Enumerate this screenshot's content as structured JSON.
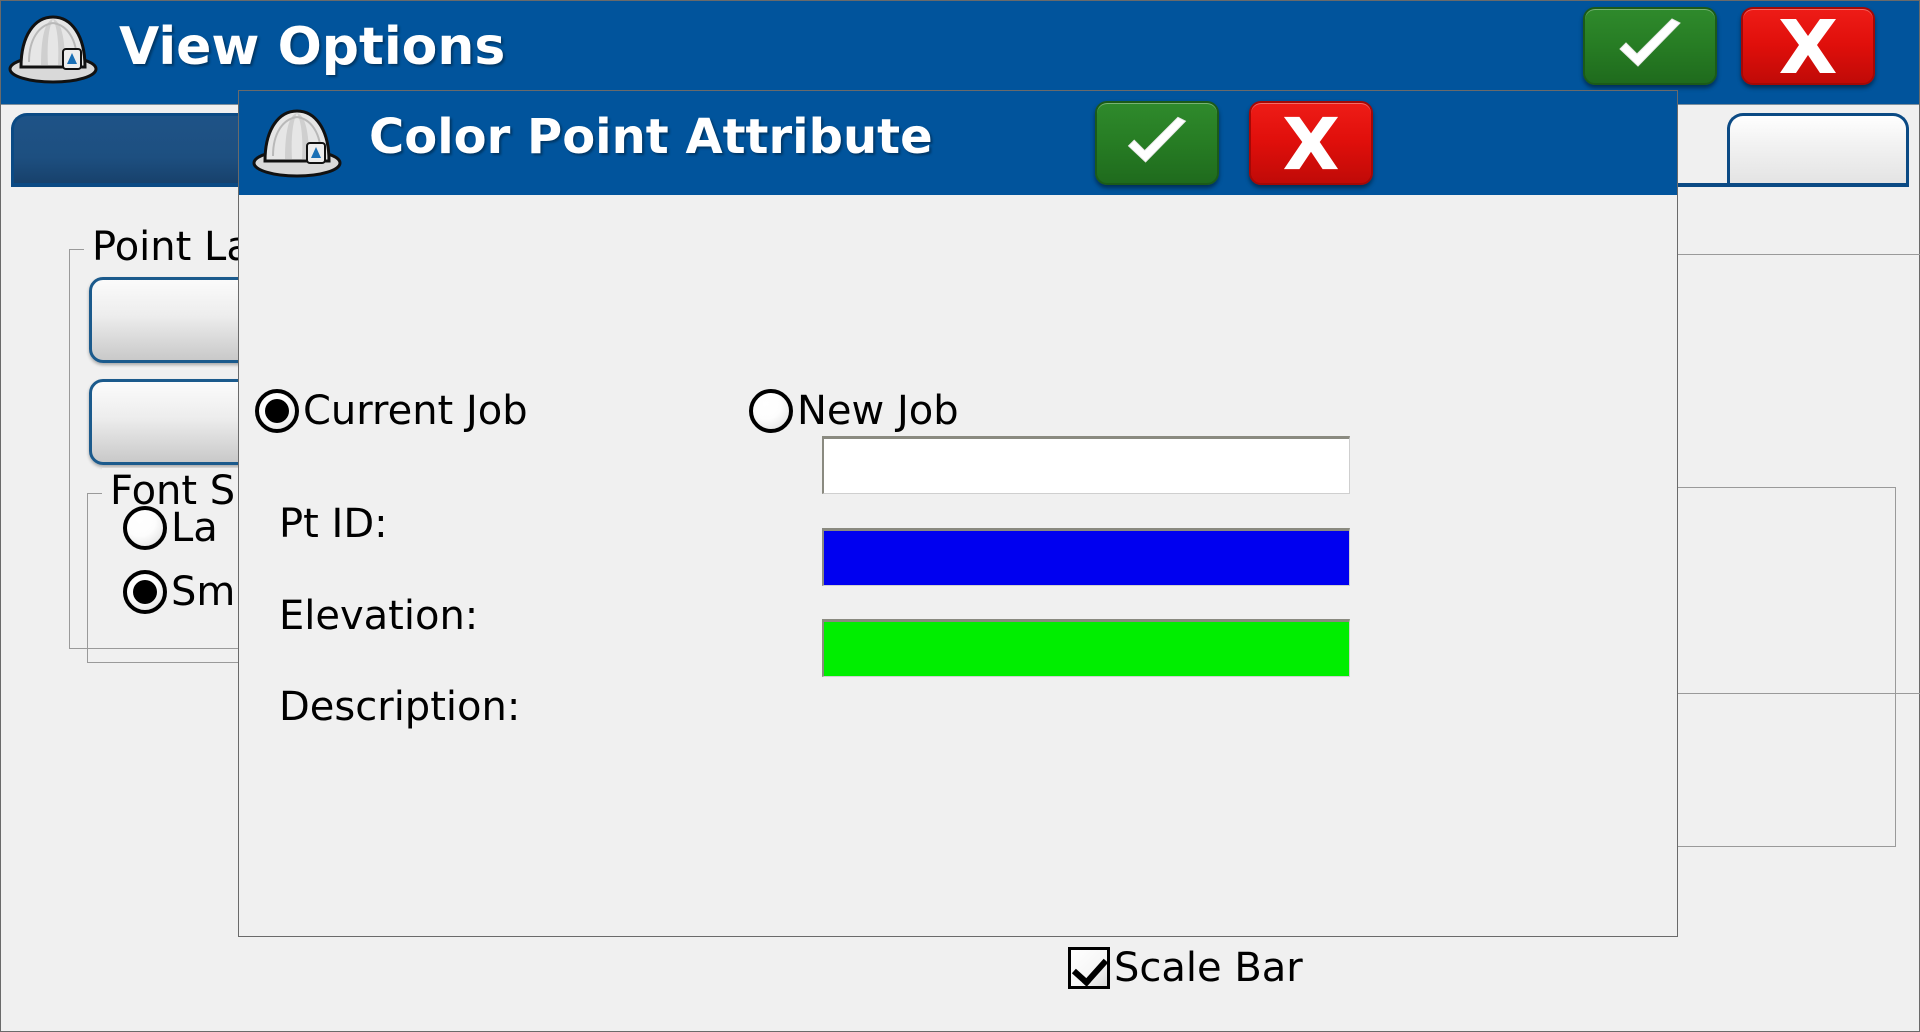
{
  "main_window": {
    "title": "View Options",
    "icon": "hardhat-icon",
    "confirm_label": "OK",
    "cancel_label": "Cancel",
    "confirm_icon": "check-icon",
    "cancel_icon": "x-icon",
    "tabs": [
      {
        "label": "",
        "state": "active"
      },
      {
        "label": "",
        "state": "inactive"
      }
    ],
    "groups": [
      {
        "title": "Point La",
        "full_title": "Point Labels"
      },
      {
        "title": "Font Si",
        "full_title": "Font Size"
      }
    ],
    "buttons": [
      {
        "label": ""
      },
      {
        "label": ""
      }
    ],
    "font_size_options": [
      {
        "label": "La",
        "full_label": "Large",
        "selected": false
      },
      {
        "label": "Sm",
        "full_label": "Small",
        "selected": true
      }
    ],
    "scale_bar": {
      "label": "Scale Bar",
      "checked": true
    }
  },
  "dialog": {
    "title": "Color Point Attribute",
    "icon": "hardhat-icon",
    "confirm_label": "OK",
    "cancel_label": "Cancel",
    "confirm_icon": "check-icon",
    "cancel_icon": "x-icon",
    "job_options": [
      {
        "label": "Current Job",
        "selected": true
      },
      {
        "label": "New Job",
        "selected": false
      }
    ],
    "fields": [
      {
        "label": "Pt ID:",
        "color": "#ffffff"
      },
      {
        "label": "Elevation:",
        "color": "#0000f0"
      },
      {
        "label": "Description:",
        "color": "#00ee00"
      }
    ]
  },
  "colors": {
    "titlebar_blue": "#01549C",
    "panel_gray": "#f0f0f0",
    "tab_border_blue": "#0b4a84",
    "confirm_green": "#277d24",
    "cancel_red": "#e00f0b"
  }
}
